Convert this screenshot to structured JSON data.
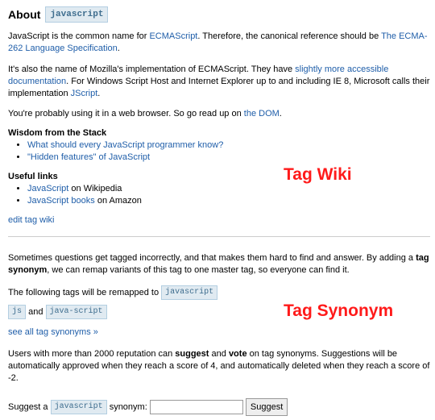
{
  "about": {
    "heading": "About",
    "tag": "javascript"
  },
  "wiki": {
    "p1_a": "JavaScript is the common name for ",
    "p1_link1": "ECMAScript",
    "p1_b": ". Therefore, the canonical reference should be ",
    "p1_link2": "The ECMA-262 Language Specification",
    "p1_c": ".",
    "p2_a": "It's also the name of Mozilla's implementation of ECMAScript. They have ",
    "p2_link1": "slightly more accessible documentation",
    "p2_b": ". For Windows Script Host and Internet Explorer up to and including IE 8, Microsoft calls their implementation ",
    "p2_link2": "JScript",
    "p2_c": ".",
    "p3_a": "You're probably using it in a web browser. So go read up on ",
    "p3_link": "the DOM",
    "p3_b": ".",
    "wisdom_heading": "Wisdom from the Stack",
    "wisdom_items": [
      {
        "link": "What should every JavaScript programmer know?",
        "after": ""
      },
      {
        "link": "\"Hidden features\" of JavaScript",
        "after": ""
      }
    ],
    "links_heading": "Useful links",
    "link_items": [
      {
        "link": "JavaScript",
        "after": " on Wikipedia"
      },
      {
        "link": "JavaScript books",
        "after": " on Amazon"
      }
    ],
    "edit_link": "edit tag wiki"
  },
  "synonyms": {
    "intro_a": "Sometimes questions get tagged incorrectly, and that makes them hard to find and answer. By adding a ",
    "intro_bold": "tag synonym",
    "intro_b": ", we can remap variants of this tag to one master tag, so everyone can find it.",
    "remap_text": "The following tags will be remapped to",
    "master_tag": "javascript",
    "syn_tag1": "js",
    "and_text": "and",
    "syn_tag2": "java-script",
    "see_all": "see all tag synonyms »",
    "rep_a": "Users with more than 2000 reputation can ",
    "rep_bold1": "suggest",
    "rep_b": " and ",
    "rep_bold2": "vote",
    "rep_c": " on tag synonyms. Suggestions will be automatically approved when they reach a score of 4, and automatically deleted when they reach a score of -2.",
    "suggest_a": "Suggest a",
    "suggest_tag": "javascript",
    "suggest_b": "synonym:",
    "input_value": "",
    "button_label": "Suggest"
  },
  "annotations": {
    "wiki": "Tag Wiki",
    "synonym": "Tag Synonym"
  },
  "colors": {
    "link": "#1f5ea9",
    "annotation": "#ff1a1a",
    "tag_bg": "#e0eaf1"
  }
}
